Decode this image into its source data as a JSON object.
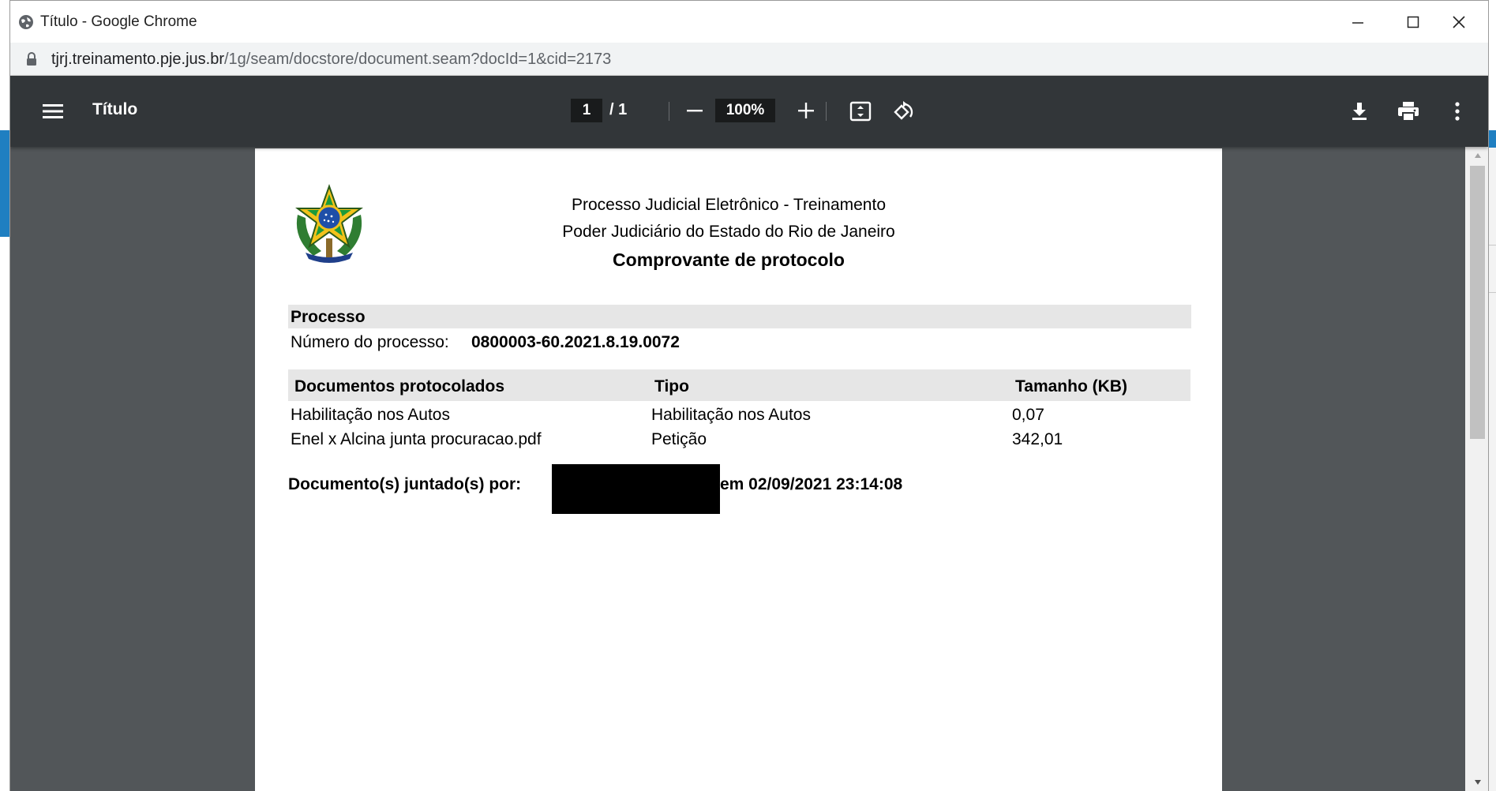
{
  "window": {
    "title": "Título - Google Chrome",
    "url_host": "tjrj.treinamento.pje.jus.br",
    "url_path": "/1g/seam/docstore/document.seam?docId=1&cid=2173"
  },
  "pdf_toolbar": {
    "doc_title": "Título",
    "current_page": "1",
    "page_total": "/ 1",
    "zoom": "100%"
  },
  "document": {
    "header_line1": "Processo Judicial Eletrônico - Treinamento",
    "header_line2": "Poder Judiciário do Estado do Rio de Janeiro",
    "header_title": "Comprovante de protocolo",
    "section_title": "Processo",
    "process_number_label": "Número do processo:",
    "process_number": "0800003-60.2021.8.19.0072",
    "table_headers": [
      "Documentos protocolados",
      "Tipo",
      "Tamanho (KB)"
    ],
    "rows": [
      {
        "name": "Habilitação nos Autos",
        "type": "Habilitação nos Autos",
        "size": "0,07"
      },
      {
        "name": "Enel x Alcina junta procuracao.pdf",
        "type": "Petição",
        "size": "342,01"
      }
    ],
    "joined_by_label": "Documento(s) juntado(s) por:",
    "joined_at": "em 02/09/2021 23:14:08"
  },
  "colors": {
    "toolbar": "#323639",
    "viewer_bg": "#525659",
    "table_header_bg": "#e6e6e6"
  }
}
